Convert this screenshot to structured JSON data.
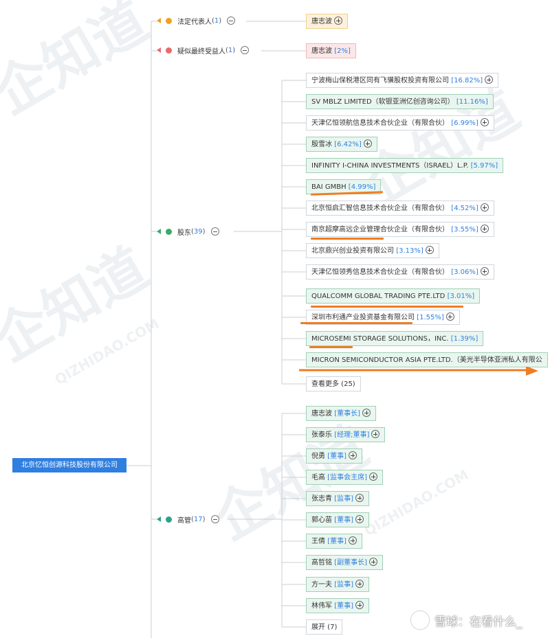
{
  "root": "北京忆恒创源科技股份有限公司",
  "branches": {
    "legal_rep": {
      "label": "法定代表人",
      "count": "1",
      "color": "#f0a020"
    },
    "beneficiary": {
      "label": "疑似最终受益人",
      "count": "1",
      "color": "#e86a6a"
    },
    "shareholders": {
      "label": "股东",
      "count": "39",
      "color": "#3aaa6a"
    },
    "executives": {
      "label": "高管",
      "count": "17",
      "color": "#2aa28a"
    }
  },
  "legal_rep_node": {
    "name": "唐志波"
  },
  "beneficiary_node": {
    "name": "唐志波",
    "pct": "2%"
  },
  "shareholders": [
    {
      "name": "宁波梅山保税港区同有飞骥股权投资有限公司",
      "pct": "16.82%"
    },
    {
      "name": "SV MBLZ LIMITED（软银亚洲亿创咨询公司）",
      "pct": "11.16%"
    },
    {
      "name": "天津亿恒领航信息技术合伙企业（有限合伙）",
      "pct": "6.99%"
    },
    {
      "name": "殷雪冰",
      "pct": "6.42%"
    },
    {
      "name": "INFINITY I-CHINA INVESTMENTS（ISRAEL）L.P.",
      "pct": "5.97%"
    },
    {
      "name": "BAI GMBH",
      "pct": "4.99%"
    },
    {
      "name": "北京恒启汇智信息技术合伙企业（有限合伙）",
      "pct": "4.52%"
    },
    {
      "name": "南京超摩高远企业管理合伙企业（有限合伙）",
      "pct": "3.55%"
    },
    {
      "name": "北京鼎兴创业投资有限公司",
      "pct": "3.13%"
    },
    {
      "name": "天津亿恒领秀信息技术合伙企业（有限合伙）",
      "pct": "3.06%"
    },
    {
      "name": "QUALCOMM GLOBAL TRADING PTE.LTD",
      "pct": "3.01%"
    },
    {
      "name": "深圳市利通产业投资基金有限公司",
      "pct": "1.55%"
    },
    {
      "name": "MICROSEMI STORAGE SOLUTIONS，INC.",
      "pct": "1.39%"
    },
    {
      "name": "MICRON SEMICONDUCTOR ASIA PTE.LTD.（美光半导体亚洲私人有限公"
    }
  ],
  "more_shareholders": "查看更多 (25)",
  "executives": [
    {
      "name": "唐志波",
      "role": "董事长"
    },
    {
      "name": "张泰乐",
      "role": "经理;董事"
    },
    {
      "name": "倪勇",
      "role": "董事"
    },
    {
      "name": "毛高",
      "role": "监事会主席"
    },
    {
      "name": "张志青",
      "role": "监事"
    },
    {
      "name": "郭心苗",
      "role": "董事"
    },
    {
      "name": "王倩",
      "role": "董事"
    },
    {
      "name": "高哲铭",
      "role": "副董事长"
    },
    {
      "name": "方一夫",
      "role": "监事"
    },
    {
      "name": "林伟军",
      "role": "董事"
    }
  ],
  "expand_executives": "展开 (7)",
  "watermark": {
    "brand": "企知道",
    "url": "QIZHIDAO.COM"
  },
  "footer": "雪球：在看什么_",
  "annotation_color": "#ef7d22"
}
